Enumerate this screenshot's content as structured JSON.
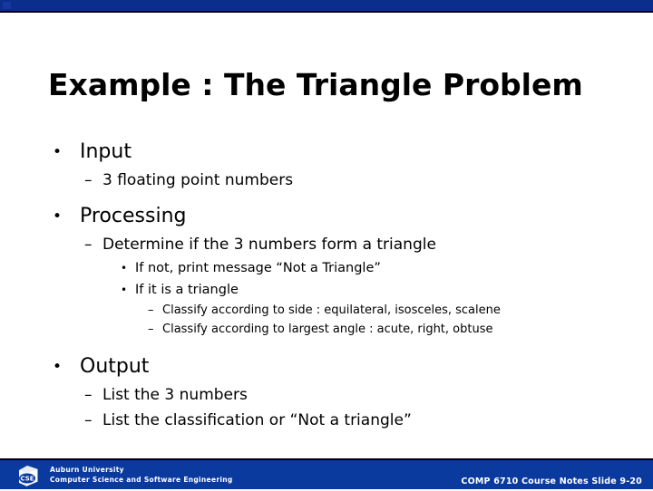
{
  "theme": {
    "top_band_color": "#0b2d8c",
    "footer_band_color": "#0b3a9e",
    "background_color": "#ffffff",
    "text_color": "#000000",
    "footer_text_color": "#ffffff"
  },
  "title": "Example : The Triangle Problem",
  "content": [
    {
      "level": 1,
      "marker": "•",
      "text": "Input"
    },
    {
      "level": 2,
      "marker": "–",
      "text": "3 floating point numbers"
    },
    {
      "level": 1,
      "marker": "•",
      "text": "Processing"
    },
    {
      "level": 2,
      "marker": "–",
      "text": "Determine if the 3 numbers form a triangle"
    },
    {
      "level": 3,
      "marker": "•",
      "text": "If not, print message “Not a Triangle”"
    },
    {
      "level": 3,
      "marker": "•",
      "text": "If it is a triangle"
    },
    {
      "level": 4,
      "marker": "–",
      "text": "Classify according to side : equilateral, isosceles, scalene"
    },
    {
      "level": 4,
      "marker": "–",
      "text": "Classify according to largest angle : acute, right, obtuse"
    },
    {
      "level": 1,
      "marker": "•",
      "text": "Output"
    },
    {
      "level": 2,
      "marker": "–",
      "text": "List the 3 numbers"
    },
    {
      "level": 2,
      "marker": "–",
      "text": "List the classification or “Not a triangle”"
    }
  ],
  "footer": {
    "logo_name": "cse-cube-logo",
    "logo_text": "CSE",
    "organization": "Auburn University",
    "department": "Computer Science and Software Engineering",
    "slide_reference": "COMP 6710 Course Notes Slide 9-20"
  }
}
